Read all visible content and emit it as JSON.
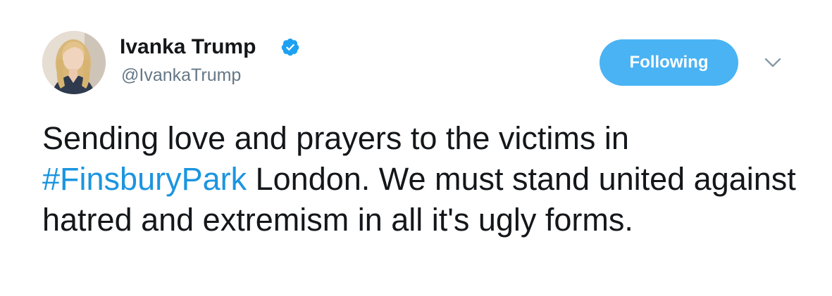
{
  "author": {
    "display_name": "Ivanka Trump",
    "handle": "@IvankaTrump",
    "verified": true,
    "avatar_icon": "profile-photo"
  },
  "actions": {
    "follow_label": "Following",
    "menu_icon": "chevron-down-icon"
  },
  "tweet": {
    "text_before": "Sending love and prayers to the victims in ",
    "hashtag": "#FinsburyPark",
    "text_after": " London. We must stand united against hatred and extremism in all it's ugly forms."
  },
  "colors": {
    "button_bg": "#4ab3f4",
    "link": "#1b95e0",
    "verified_badge": "#1da1f2",
    "handle_text": "#657786",
    "body_text": "#14171a"
  }
}
